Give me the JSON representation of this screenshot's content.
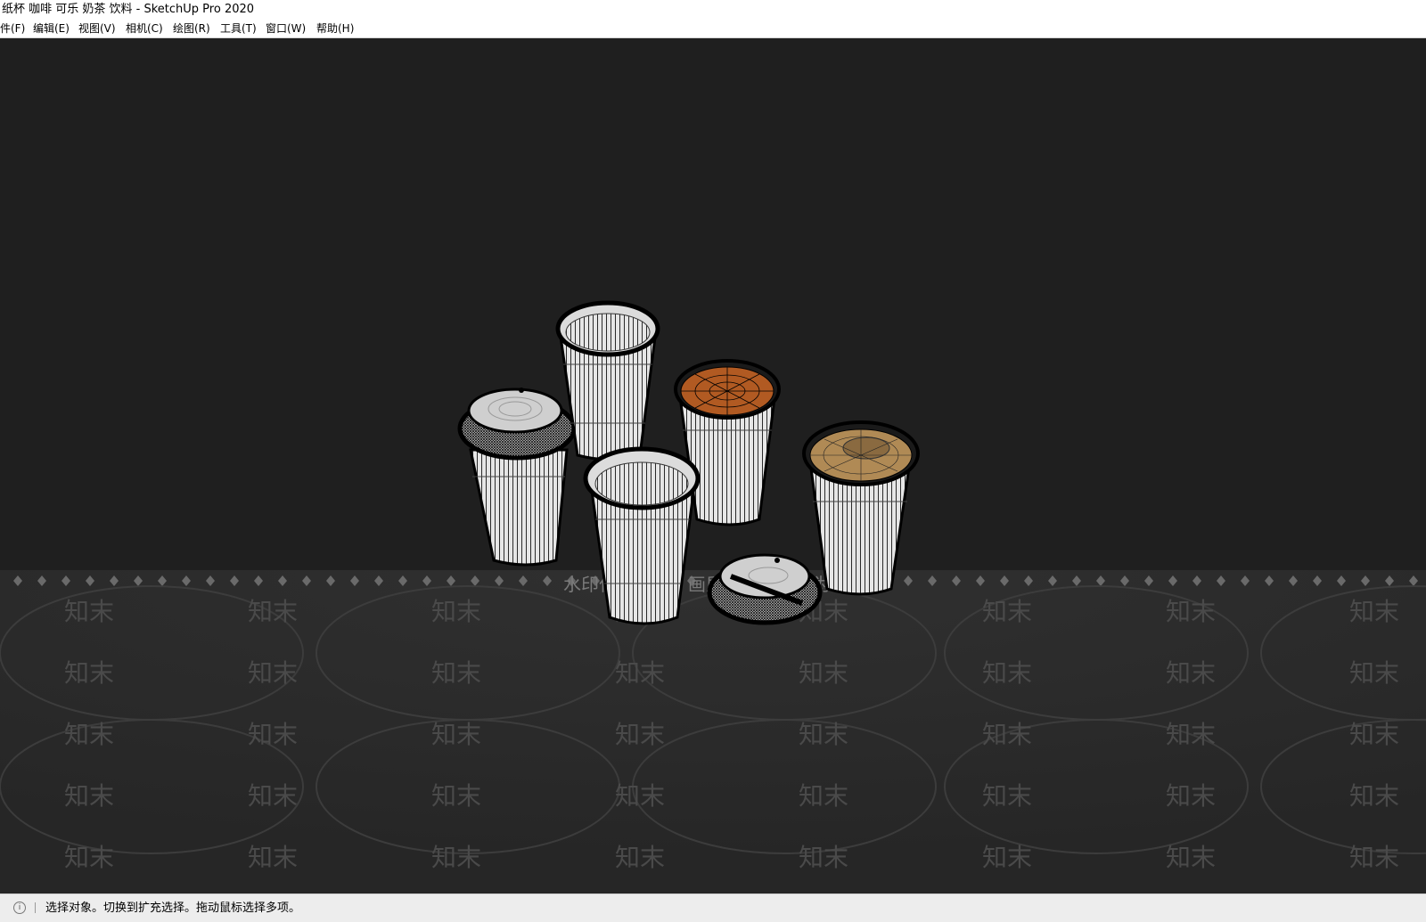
{
  "window": {
    "title": "纸杯 咖啡 可乐 奶茶 饮料 - SketchUp Pro 2020"
  },
  "menubar": {
    "items": [
      "件(F)",
      "编辑(E)",
      "视图(V)",
      "相机(C)",
      "绘图(R)",
      "工具(T)",
      "窗口(W)",
      "帮助(H)"
    ]
  },
  "viewport": {
    "background": "#1f1f1f",
    "watermark_brand": "知末",
    "watermark_notice": "水印仅展示区，画质最终以下载为准",
    "model": {
      "objects": [
        "cup-with-lid",
        "empty-cup",
        "cup-with-cola",
        "empty-cup",
        "cup-with-milk-tea",
        "loose-lid"
      ],
      "cola_color": "#b15a22",
      "milk_tea_color": "#b08a55"
    }
  },
  "statusbar": {
    "icon": "info-icon",
    "text": "选择对象。切换到扩充选择。拖动鼠标选择多项。"
  }
}
